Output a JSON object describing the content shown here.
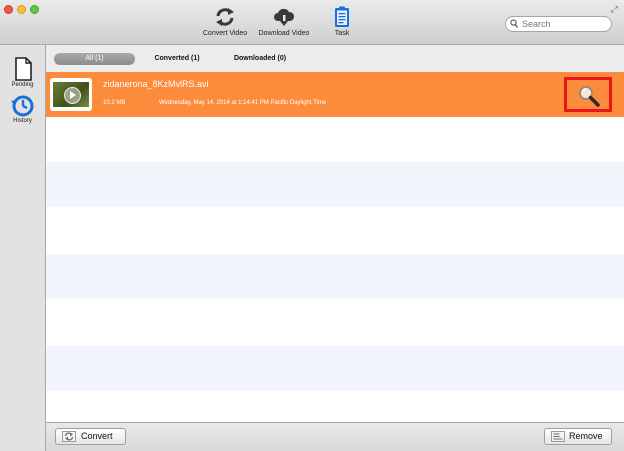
{
  "toolbar": {
    "convert_label": "Convert Video",
    "download_label": "Download Video",
    "task_label": "Task",
    "search_placeholder": "Search"
  },
  "sidebar": {
    "items": [
      {
        "label": "Pending",
        "icon": "document-icon"
      },
      {
        "label": "History",
        "icon": "history-clock-icon"
      }
    ]
  },
  "tabs": [
    {
      "label": "All (1)",
      "selected": true
    },
    {
      "label": "Converted (1)",
      "selected": false
    },
    {
      "label": "Downloaded (0)",
      "selected": false
    }
  ],
  "items": [
    {
      "filename": "zidanerona_8KzMvlRS.avi",
      "size": "10.2 MB",
      "date": "Wednesday, May 14, 2014 at 1:14:41 PM Pacific Daylight Time",
      "selected": true
    }
  ],
  "bottom": {
    "convert_label": "Convert",
    "remove_label": "Remove"
  },
  "colors": {
    "selected_row": "#fc8b3b",
    "highlight_box": "#e8161b",
    "accent_blue": "#1b6fd8"
  }
}
